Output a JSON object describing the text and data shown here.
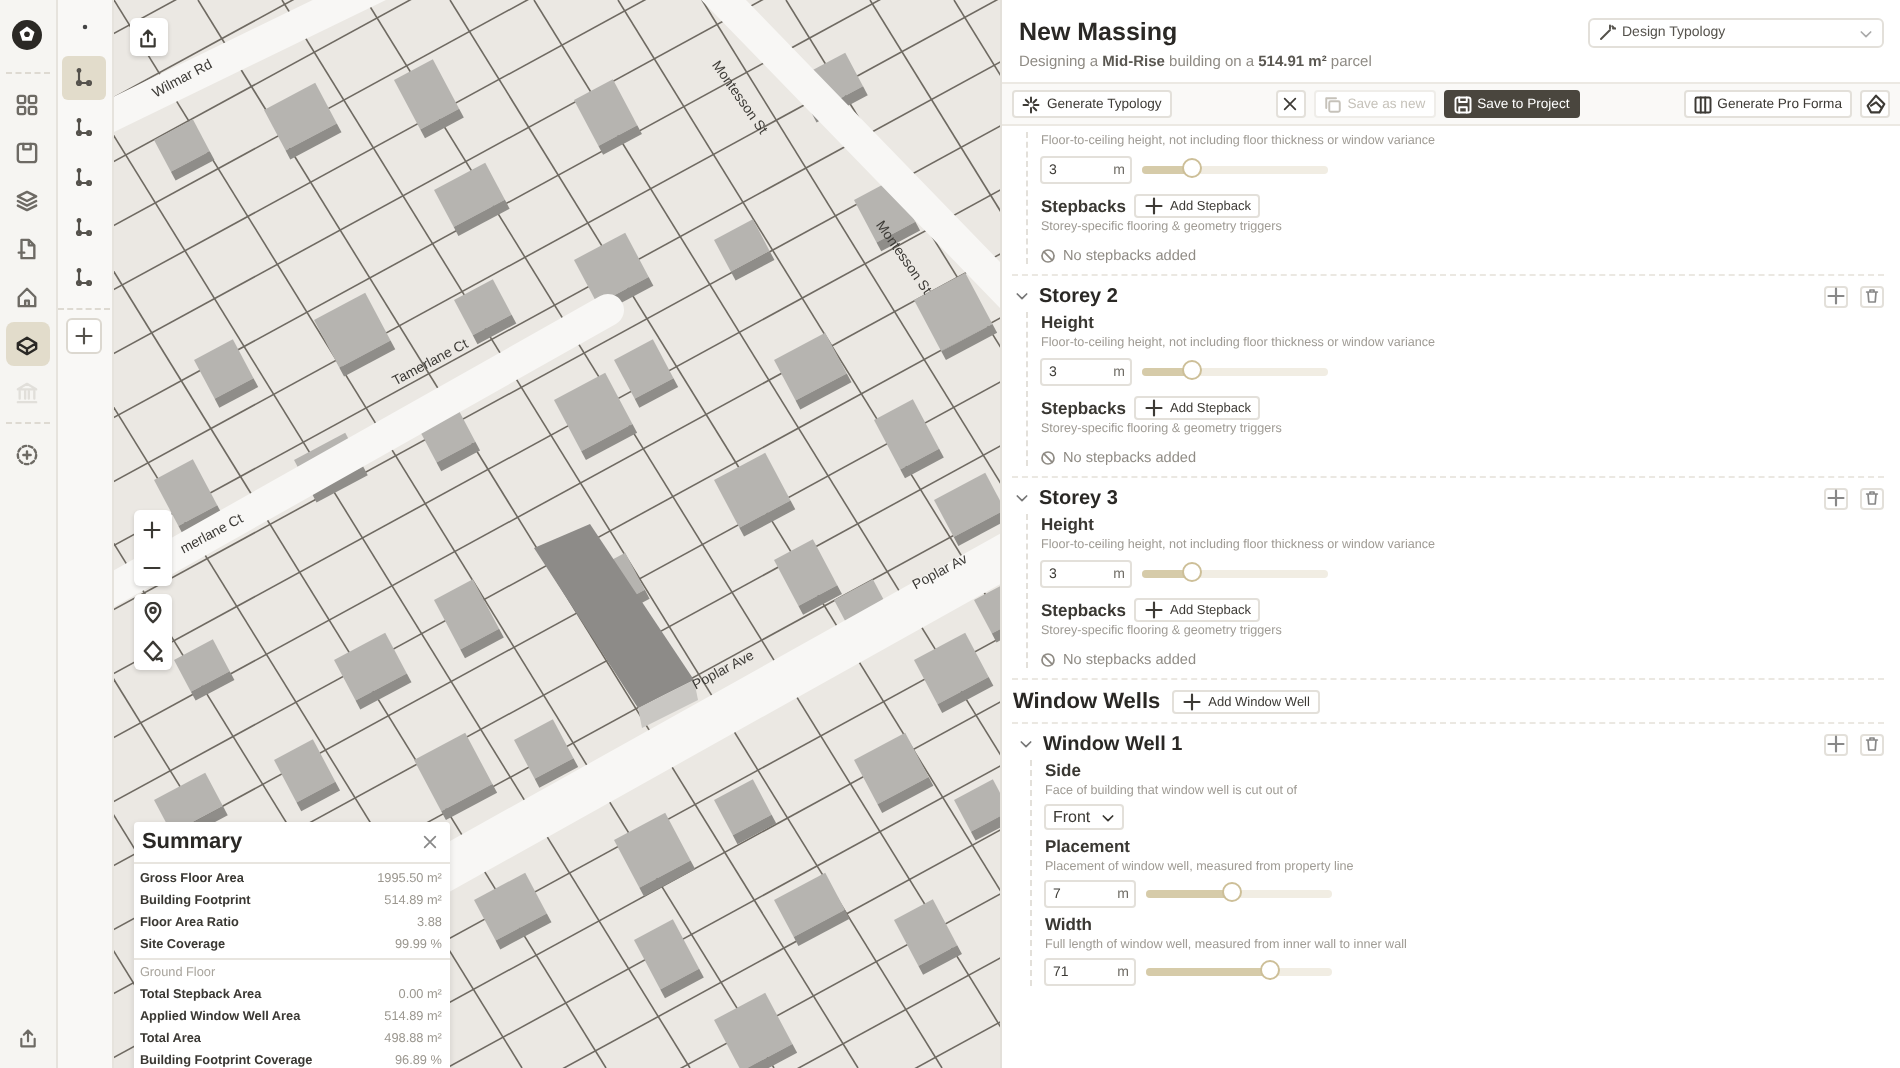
{
  "nav_rail": {
    "items": [
      {
        "kind": "logo",
        "selected": false,
        "disabled": false
      },
      {
        "kind": "grid",
        "selected": false,
        "disabled": false
      },
      {
        "kind": "save",
        "selected": false,
        "disabled": false
      },
      {
        "kind": "layers",
        "selected": false,
        "disabled": false
      },
      {
        "kind": "document",
        "selected": false,
        "disabled": false
      },
      {
        "kind": "home",
        "selected": false,
        "disabled": false
      },
      {
        "kind": "cube",
        "selected": true,
        "disabled": false
      },
      {
        "kind": "bank",
        "selected": false,
        "disabled": true
      },
      {
        "kind": "add",
        "selected": false,
        "disabled": false
      }
    ]
  },
  "tool_rail": {
    "items": [
      {
        "selected": true
      },
      {
        "selected": false
      },
      {
        "selected": false
      },
      {
        "selected": false
      },
      {
        "selected": false
      }
    ]
  },
  "map": {
    "street_labels": [
      "Wilmar Rd",
      "Montesson St",
      "Montesson St",
      "Tamerlane Ct",
      "merlane Ct",
      "Poplar Ave",
      "Poplar Av"
    ]
  },
  "summary": {
    "title": "Summary",
    "rows": [
      {
        "label": "Gross Floor Area",
        "value": "1995.50 m²"
      },
      {
        "label": "Building Footprint",
        "value": "514.89 m²"
      },
      {
        "label": "Floor Area Ratio",
        "value": "3.88"
      },
      {
        "label": "Site Coverage",
        "value": "99.99 %"
      }
    ],
    "section": "Ground Floor",
    "section_rows": [
      {
        "label": "Total Stepback Area",
        "value": "0.00 m²"
      },
      {
        "label": "Applied Window Well Area",
        "value": "514.89 m²"
      },
      {
        "label": "Total Area",
        "value": "498.88 m²"
      },
      {
        "label": "Building Footprint Coverage",
        "value": "96.89 %"
      }
    ]
  },
  "panel": {
    "title": "New Massing",
    "subtitle": "Designing a **Mid-Rise** building on a **514.91 m²** parcel",
    "dropdown": "Design Typology",
    "toolbar": [
      {
        "kind": "generate",
        "label": "Generate Typology",
        "disabled": false
      },
      {
        "kind": "close",
        "disabled": false
      },
      {
        "kind": "save_new",
        "label": "Save as new",
        "disabled": true
      },
      {
        "kind": "save_project",
        "label": "Save to Project",
        "disabled": false
      },
      {
        "kind": "pro_forma",
        "label": "Generate Pro Forma",
        "disabled": false
      },
      {
        "kind": "icon",
        "disabled": false
      }
    ],
    "storeys": [
      {
        "height": {
          "description": "Floor-to-ceiling height, not including floor thickness or window variance",
          "value": "3",
          "unit": "m",
          "level": 0.26
        },
        "stepbacks": {
          "label": "Stepbacks",
          "button": "Add Stepback",
          "description": "Storey-specific flooring & geometry triggers",
          "empty": "No stepbacks added"
        }
      },
      {
        "title": "Storey 2",
        "expanded": true,
        "height": {
          "label": "Height",
          "description": "Floor-to-ceiling height, not including floor thickness or window variance",
          "value": "3",
          "unit": "m",
          "level": 0.26
        },
        "stepbacks": {
          "label": "Stepbacks",
          "button": "Add Stepback",
          "description": "Storey-specific flooring & geometry triggers",
          "empty": "No stepbacks added"
        }
      },
      {
        "title": "Storey 3",
        "expanded": true,
        "height": {
          "label": "Height",
          "description": "Floor-to-ceiling height, not including floor thickness or window variance",
          "value": "3",
          "unit": "m",
          "level": 0.26
        },
        "stepbacks": {
          "label": "Stepbacks",
          "button": "Add Stepback",
          "description": "Storey-specific flooring & geometry triggers",
          "empty": "No stepbacks added"
        }
      }
    ],
    "window_wells": {
      "title": "Window Wells",
      "button": "Add Window Well",
      "items": [
        {
          "title": "Window Well 1",
          "expanded": true,
          "fields": [
            {
              "kind": "select",
              "label": "Side",
              "description": "Face of building that window well is cut out of",
              "value": "Front"
            },
            {
              "kind": "slider",
              "label": "Placement",
              "description": "Placement of window well, measured from property line",
              "value": "7",
              "unit": "m",
              "level": 0.46
            },
            {
              "kind": "slider",
              "label": "Width",
              "description": "Full length of window well, measured from inner wall to inner wall",
              "value": "71",
              "unit": "m",
              "level": 0.66
            }
          ]
        }
      ]
    }
  }
}
